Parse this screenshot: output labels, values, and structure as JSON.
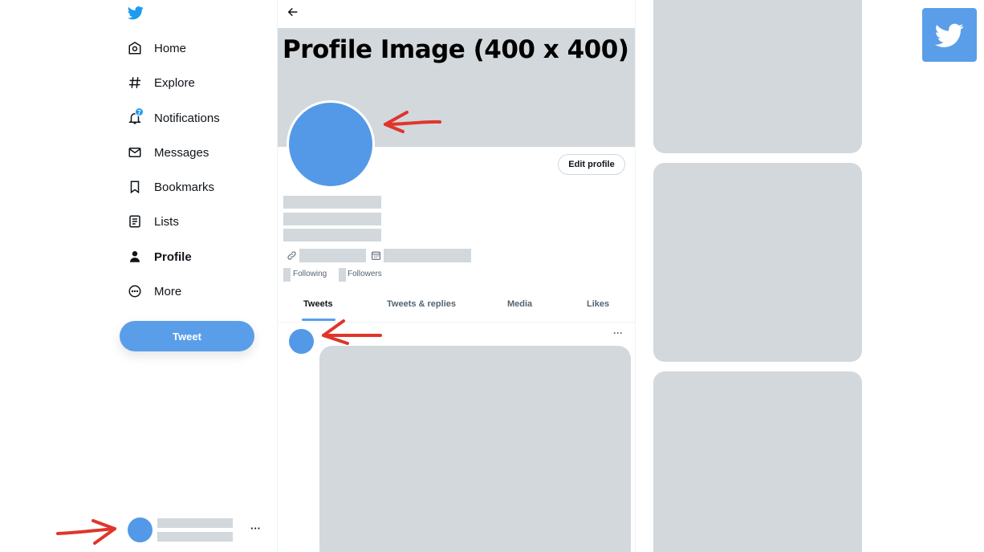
{
  "sidebar": {
    "items": [
      {
        "label": "Home",
        "icon": "home-icon"
      },
      {
        "label": "Explore",
        "icon": "hashtag-icon"
      },
      {
        "label": "Notifications",
        "icon": "bell-icon",
        "badge": "7"
      },
      {
        "label": "Messages",
        "icon": "envelope-icon"
      },
      {
        "label": "Bookmarks",
        "icon": "bookmark-icon"
      },
      {
        "label": "Lists",
        "icon": "list-icon"
      },
      {
        "label": "Profile",
        "icon": "person-icon",
        "active": true
      },
      {
        "label": "More",
        "icon": "more-circle-icon"
      }
    ],
    "tweet_button": "Tweet",
    "account_more": "···"
  },
  "main": {
    "back_icon": "arrow-left-icon",
    "headline": "Profile Image (400 x 400)",
    "edit_profile": "Edit profile",
    "following_label": "Following",
    "followers_label": "Followers",
    "tabs": [
      {
        "label": "Tweets",
        "active": true
      },
      {
        "label": "Tweets & replies"
      },
      {
        "label": "Media"
      },
      {
        "label": "Likes"
      }
    ],
    "tweet_more": "···"
  },
  "colors": {
    "accent": "#1d9bf0",
    "placeholder": "#d2d8dc",
    "avatar": "#5499e8",
    "annotation_arrow": "#e0352b"
  }
}
